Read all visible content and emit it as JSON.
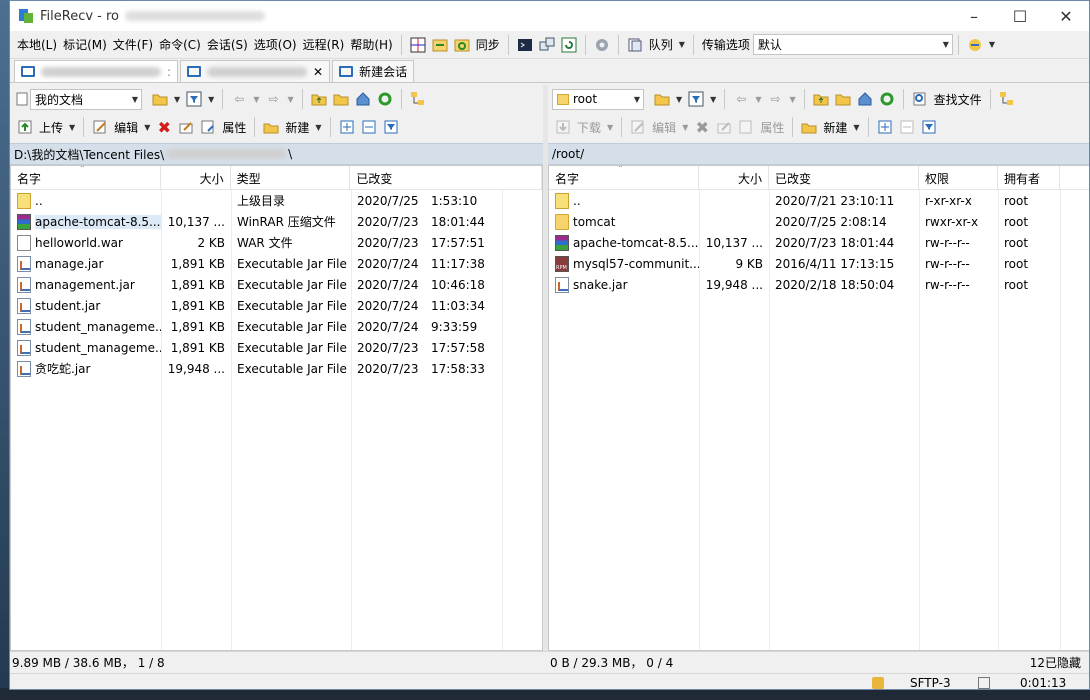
{
  "window": {
    "title": "FileRecv - ro"
  },
  "menu": [
    "本地(L)",
    "标记(M)",
    "文件(F)",
    "命令(C)",
    "会话(S)",
    "选项(O)",
    "远程(R)",
    "帮助(H)"
  ],
  "toolbar": {
    "sync_label": "同步",
    "queue_label": "队列",
    "transfer_label": "传输选项",
    "transfer_value": "默认"
  },
  "tabs": {
    "new_session": "新建会话"
  },
  "left": {
    "location": "我的文档",
    "actions": {
      "upload": "上传",
      "edit": "编辑",
      "properties": "属性",
      "new": "新建"
    },
    "path": "D:\\我的文档\\Tencent Files\\",
    "path_tail": "\\",
    "columns": [
      "名字",
      "大小",
      "类型",
      "已改变"
    ],
    "rows": [
      {
        "name": "..",
        "size": "",
        "type": "上级目录",
        "date": "2020/7/25",
        "time": "1:53:10",
        "icon": "up-folder-icon"
      },
      {
        "name": "apache-tomcat-8.5....",
        "size": "10,137 ...",
        "type": "WinRAR 压缩文件",
        "date": "2020/7/23",
        "time": "18:01:44",
        "icon": "archive-icon"
      },
      {
        "name": "helloworld.war",
        "size": "2 KB",
        "type": "WAR 文件",
        "date": "2020/7/23",
        "time": "17:57:51",
        "icon": "file-icon"
      },
      {
        "name": "manage.jar",
        "size": "1,891 KB",
        "type": "Executable Jar File",
        "date": "2020/7/24",
        "time": "11:17:38",
        "icon": "jar-icon"
      },
      {
        "name": "management.jar",
        "size": "1,891 KB",
        "type": "Executable Jar File",
        "date": "2020/7/24",
        "time": "10:46:18",
        "icon": "jar-icon"
      },
      {
        "name": "student.jar",
        "size": "1,891 KB",
        "type": "Executable Jar File",
        "date": "2020/7/24",
        "time": "11:03:34",
        "icon": "jar-icon"
      },
      {
        "name": "student_manageme...",
        "size": "1,891 KB",
        "type": "Executable Jar File",
        "date": "2020/7/24",
        "time": "9:33:59",
        "icon": "jar-icon"
      },
      {
        "name": "student_manageme...",
        "size": "1,891 KB",
        "type": "Executable Jar File",
        "date": "2020/7/23",
        "time": "17:57:58",
        "icon": "jar-icon"
      },
      {
        "name": "贪吃蛇.jar",
        "size": "19,948 ...",
        "type": "Executable Jar File",
        "date": "2020/7/23",
        "time": "17:58:33",
        "icon": "jar-icon"
      }
    ],
    "status": "9.89 MB / 38.6 MB， 1 / 8"
  },
  "right": {
    "location": "root",
    "actions": {
      "download": "下载",
      "edit": "编辑",
      "properties": "属性",
      "new": "新建",
      "find": "查找文件"
    },
    "path": "/root/",
    "columns": [
      "名字",
      "大小",
      "已改变",
      "权限",
      "拥有者"
    ],
    "rows": [
      {
        "name": "..",
        "size": "",
        "changed": "2020/7/21 23:10:11",
        "perm": "r-xr-xr-x",
        "owner": "root",
        "icon": "up-folder-icon"
      },
      {
        "name": "tomcat",
        "size": "",
        "changed": "2020/7/25 2:08:14",
        "perm": "rwxr-xr-x",
        "owner": "root",
        "icon": "folder-icon"
      },
      {
        "name": "apache-tomcat-8.5....",
        "size": "10,137 ...",
        "changed": "2020/7/23 18:01:44",
        "perm": "rw-r--r--",
        "owner": "root",
        "icon": "archive-icon"
      },
      {
        "name": "mysql57-communit...",
        "size": "9 KB",
        "changed": "2016/4/11 17:13:15",
        "perm": "rw-r--r--",
        "owner": "root",
        "icon": "rpm-icon"
      },
      {
        "name": "snake.jar",
        "size": "19,948 ...",
        "changed": "2020/2/18 18:50:04",
        "perm": "rw-r--r--",
        "owner": "root",
        "icon": "jar-icon"
      }
    ],
    "status": "0 B / 29.3 MB， 0 / 4",
    "hidden": "12已隐藏"
  },
  "statusbar": {
    "protocol": "SFTP-3",
    "elapsed": "0:01:13"
  }
}
